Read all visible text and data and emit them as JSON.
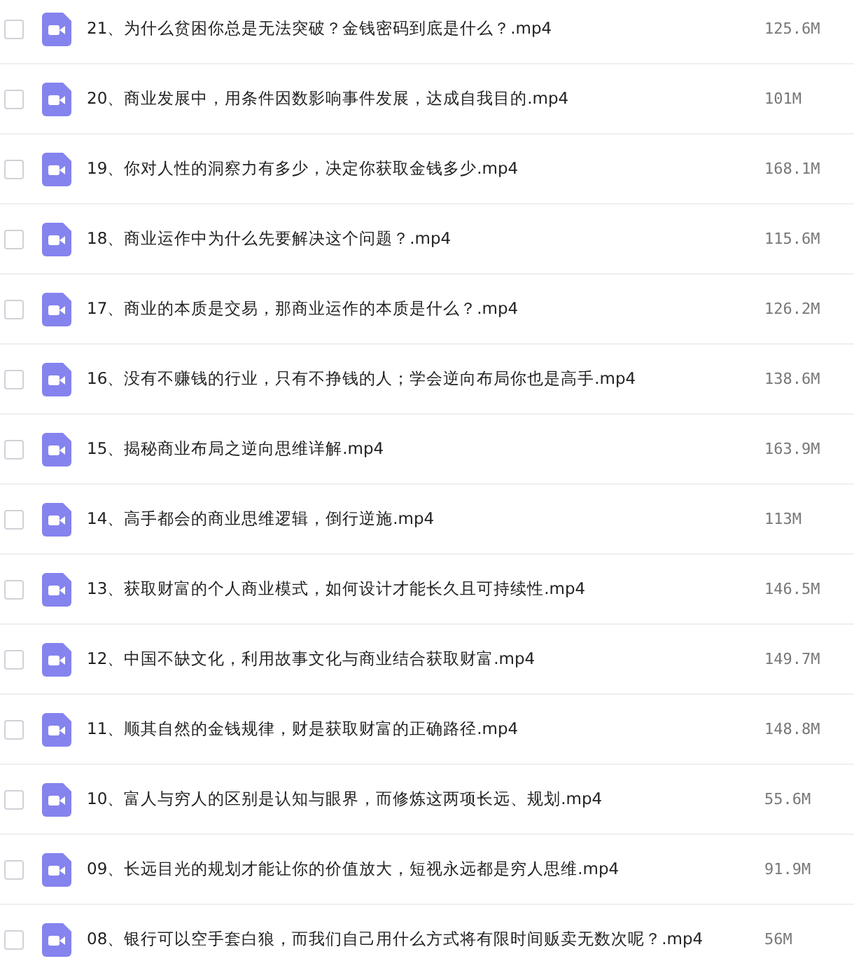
{
  "files": [
    {
      "name": "21、为什么贫困你总是无法突破？金钱密码到底是什么？.mp4",
      "size": "125.6M",
      "checked": false
    },
    {
      "name": "20、商业发展中，用条件因数影响事件发展，达成自我目的.mp4",
      "size": "101M",
      "checked": false
    },
    {
      "name": "19、你对人性的洞察力有多少，决定你获取金钱多少.mp4",
      "size": "168.1M",
      "checked": false
    },
    {
      "name": "18、商业运作中为什么先要解决这个问题？.mp4",
      "size": "115.6M",
      "checked": false
    },
    {
      "name": "17、商业的本质是交易，那商业运作的本质是什么？.mp4",
      "size": "126.2M",
      "checked": false
    },
    {
      "name": "16、没有不赚钱的行业，只有不挣钱的人；学会逆向布局你也是高手.mp4",
      "size": "138.6M",
      "checked": false
    },
    {
      "name": "15、揭秘商业布局之逆向思维详解.mp4",
      "size": "163.9M",
      "checked": false
    },
    {
      "name": "14、高手都会的商业思维逻辑，倒行逆施.mp4",
      "size": "113M",
      "checked": false
    },
    {
      "name": "13、获取财富的个人商业模式，如何设计才能长久且可持续性.mp4",
      "size": "146.5M",
      "checked": false
    },
    {
      "name": "12、中国不缺文化，利用故事文化与商业结合获取财富.mp4",
      "size": "149.7M",
      "checked": false
    },
    {
      "name": "11、顺其自然的金钱规律，财是获取财富的正确路径.mp4",
      "size": "148.8M",
      "checked": false
    },
    {
      "name": "10、富人与穷人的区别是认知与眼界，而修炼这两项长远、规划.mp4",
      "size": "55.6M",
      "checked": false
    },
    {
      "name": "09、长远目光的规划才能让你的价值放大，短视永远都是穷人思维.mp4",
      "size": "91.9M",
      "checked": false
    },
    {
      "name": "08、银行可以空手套白狼，而我们自己用什么方式将有限时间贩卖无数次呢？.mp4",
      "size": "56M",
      "checked": false
    }
  ]
}
